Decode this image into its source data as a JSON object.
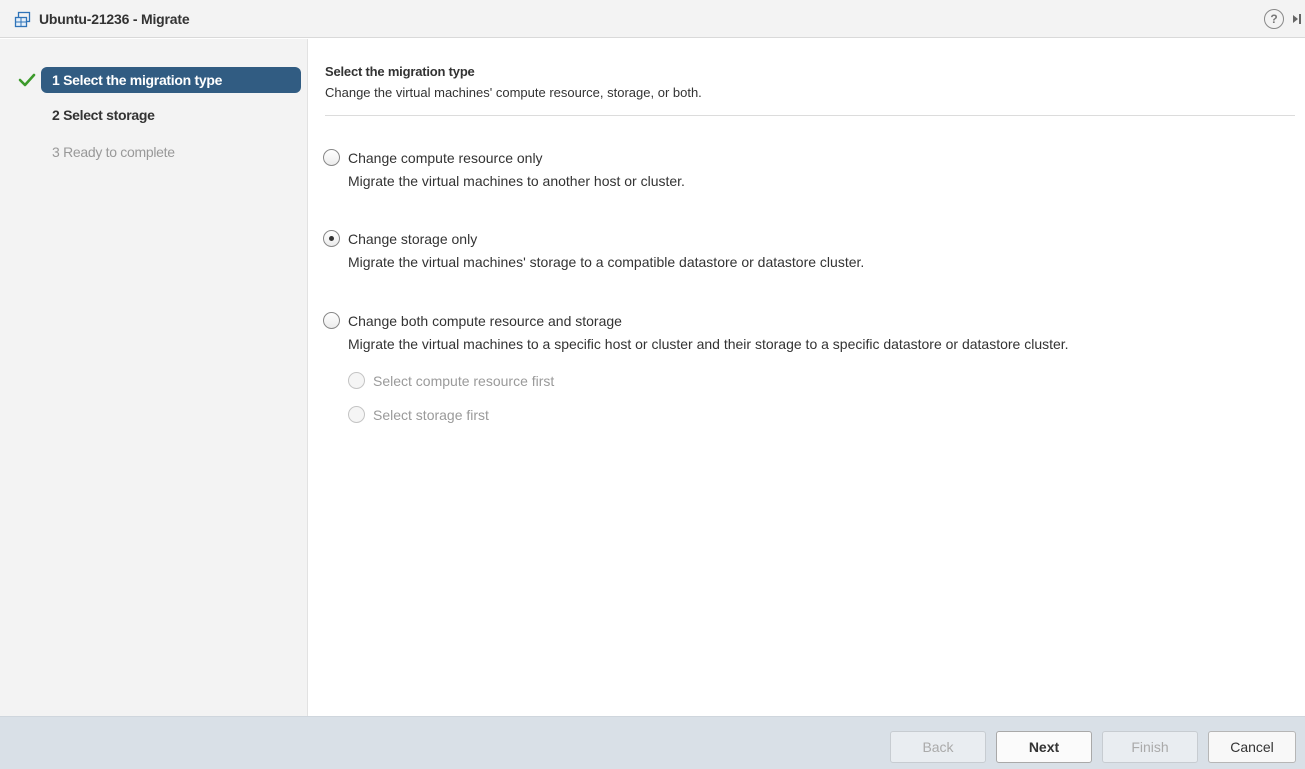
{
  "window": {
    "title": "Ubuntu-21236 - Migrate",
    "icon": "vm-icon",
    "help_glyph": "?"
  },
  "steps": [
    {
      "label": "1 Select the migration type",
      "state": "active",
      "completed": true
    },
    {
      "label": "2 Select storage",
      "state": "enabled",
      "completed": false
    },
    {
      "label": "3 Ready to complete",
      "state": "disabled",
      "completed": false
    }
  ],
  "main": {
    "heading": "Select the migration type",
    "subheading": "Change the virtual machines' compute resource, storage, or both.",
    "options": [
      {
        "label": "Change compute resource only",
        "description": "Migrate the virtual machines to another host or cluster.",
        "checked": false
      },
      {
        "label": "Change storage only",
        "description": "Migrate the virtual machines' storage to a compatible datastore or datastore cluster.",
        "checked": true
      },
      {
        "label": "Change both compute resource and storage",
        "description": "Migrate the virtual machines to a specific host or cluster and their storage to a specific datastore or datastore cluster.",
        "checked": false
      }
    ],
    "sub_options": [
      {
        "label": "Select compute resource first",
        "checked": false,
        "disabled": true
      },
      {
        "label": "Select storage first",
        "checked": false,
        "disabled": true
      }
    ]
  },
  "footer": {
    "back_label": "Back",
    "next_label": "Next",
    "finish_label": "Finish",
    "cancel_label": "Cancel"
  },
  "colors": {
    "active_step": "#315c82",
    "check": "#3c9a2b",
    "footer": "#d9e0e7"
  }
}
